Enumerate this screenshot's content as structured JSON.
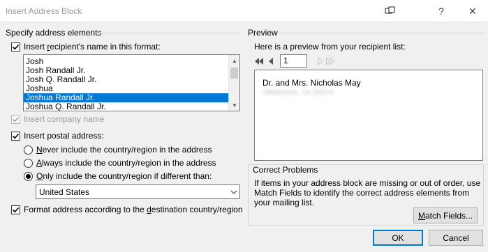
{
  "window": {
    "title": "Insert Address Block",
    "help_glyph": "?",
    "close_glyph": "✕",
    "restore_glyph": "⧉"
  },
  "left": {
    "group_label": "Specify address elements",
    "name_format": {
      "label_pre": "Insert ",
      "label_ul": "r",
      "label_post": "ecipient's name in this format:",
      "checked": true,
      "items": [
        "Josh",
        "Josh Randall Jr.",
        "Josh Q. Randall Jr.",
        "Joshua",
        "Joshua Randall Jr.",
        "Joshua Q. Randall Jr."
      ],
      "selected_index": 4
    },
    "company": {
      "label": "Insert company name",
      "checked": true,
      "enabled": false
    },
    "postal": {
      "label": "Insert postal address:",
      "checked": true,
      "never_ul": "N",
      "never_rest": "ever include the country/region in the address",
      "always_ul": "A",
      "always_rest": "lways include the country/region in the address",
      "only_ul": "O",
      "only_rest": "nly include the country/region if different than:",
      "selected": "only",
      "country": "United States"
    },
    "format_dest": {
      "label_pre": "Format address according to the ",
      "label_ul": "d",
      "label_post": "estination country/region",
      "checked": true
    }
  },
  "right": {
    "preview_label": "Preview",
    "preview_intro": "Here is a preview from your recipient list:",
    "record_number": "1",
    "preview_line1": "Dr. and Mrs. Nicholas May",
    "preview_line2_blurred": "Oklahoma, 14 20070",
    "correct_label": "Correct Problems",
    "correct_text_1": "If items in your address block are missing or out of order, use",
    "correct_text_2": "Match Fields to identify the correct address elements from",
    "correct_text_3": "your mailing list.",
    "match_fields_ul": "M",
    "match_fields_rest": "atch Fields..."
  },
  "footer": {
    "ok": "OK",
    "cancel": "Cancel"
  }
}
